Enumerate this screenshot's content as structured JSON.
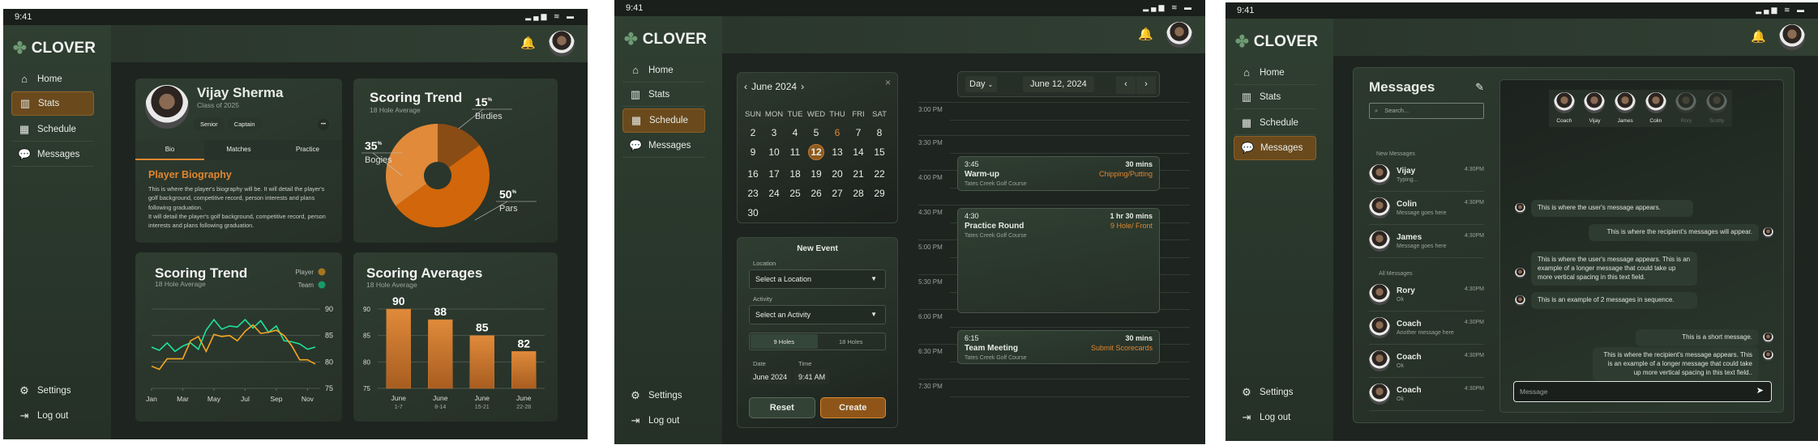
{
  "app": {
    "name": "CLOVER",
    "status_time": "9:41",
    "nav": [
      "Home",
      "Stats",
      "Schedule",
      "Messages"
    ],
    "nav_icons": [
      "home-icon",
      "stats-icon",
      "calendar-icon",
      "chat-icon"
    ],
    "settings": "Settings",
    "logout": "Log out",
    "colors": {
      "accent": "#e0862f",
      "active_nav": "#6a4a1d",
      "sidebar": "#2f3f31",
      "background": "#1e2420",
      "player": "#f5a623",
      "team": "#1fe39a"
    }
  },
  "stats": {
    "profile": {
      "name": "Vijay Sherma",
      "class": "Class of 2025",
      "tags": [
        "Senior",
        "Captain"
      ],
      "more": "•••",
      "tabs": [
        "Bio",
        "Matches",
        "Practice"
      ],
      "active_tab": "Bio",
      "bio_title": "Player Biography",
      "bio_text": "This is where the player's biography will be. It will detail the player's golf background, competitive record, person interests and plans following graduation.",
      "bio_text2": "It will detail the player's golf background, competitive record, person interests and plans following graduation."
    },
    "pie_card": {
      "title": "Scoring Trend",
      "subtitle": "18 Hole Average"
    },
    "line_card": {
      "title": "Scoring Trend",
      "subtitle": "18 Hole Average"
    },
    "bar_card": {
      "title": "Scoring Averages",
      "subtitle": "18 Hole Average"
    }
  },
  "chart_data": [
    {
      "type": "pie",
      "donut": true,
      "slices": [
        {
          "label": "Birdies",
          "value": 15,
          "color": "#8a4c15"
        },
        {
          "label": "Pars",
          "value": 50,
          "color": "#d2660a"
        },
        {
          "label": "Bogies",
          "value": 35,
          "color": "#e08a3a"
        }
      ],
      "value_suffix": "%"
    },
    {
      "type": "line",
      "xticks": [
        "Jan",
        "Mar",
        "May",
        "Jul",
        "Sep",
        "Nov"
      ],
      "xtick_values": [
        1,
        3,
        5,
        7,
        9,
        11
      ],
      "xlim": [
        1,
        11.5
      ],
      "ylim": [
        75,
        90
      ],
      "yticks": [
        75,
        80,
        85,
        90
      ],
      "y_axis_side": "right",
      "grid": true,
      "legend": "top-right",
      "x": [
        1,
        1.5,
        2,
        2.5,
        3,
        3.5,
        4,
        4.5,
        5,
        5.5,
        6,
        6.5,
        7,
        7.5,
        8,
        8.5,
        9,
        9.5,
        10,
        10.5,
        11,
        11.5
      ],
      "series": [
        {
          "name": "Player",
          "color": "#f5a623",
          "values": [
            79.2,
            78.6,
            80.6,
            80.6,
            80.6,
            84.0,
            84.8,
            82.0,
            85.2,
            84.8,
            85.0,
            84.0,
            85.8,
            87.0,
            85.4,
            85.6,
            86.0,
            85.0,
            83.0,
            80.4,
            80.4,
            79.6
          ]
        },
        {
          "name": "Team",
          "color": "#1fe39a",
          "values": [
            82.8,
            82.2,
            83.6,
            82.0,
            83.0,
            83.6,
            82.4,
            86.0,
            88.0,
            86.2,
            86.8,
            86.6,
            88.0,
            86.4,
            87.8,
            85.6,
            86.8,
            84.0,
            83.8,
            83.4,
            82.4,
            82.8
          ]
        }
      ]
    },
    {
      "type": "bar",
      "categories": [
        "June 1-7",
        "June 8-14",
        "June 15-21",
        "June 22-28"
      ],
      "category_lines": [
        [
          "June",
          "1-7"
        ],
        [
          "June",
          "8-14"
        ],
        [
          "June",
          "15-21"
        ],
        [
          "June",
          "22-28"
        ]
      ],
      "values": [
        90,
        88,
        85,
        82
      ],
      "ylim": [
        75,
        90
      ],
      "yticks": [
        75,
        80,
        85,
        90
      ],
      "grid": true,
      "color": "#d9802f"
    }
  ],
  "schedule": {
    "calendar": {
      "month": "June 2024",
      "close": "×",
      "weekdays": [
        "SUN",
        "MON",
        "TUE",
        "WED",
        "THU",
        "FRI",
        "SAT"
      ],
      "days": [
        2,
        3,
        4,
        5,
        6,
        7,
        8,
        9,
        10,
        11,
        12,
        13,
        14,
        15,
        16,
        17,
        18,
        19,
        20,
        21,
        22,
        23,
        24,
        25,
        26,
        27,
        28,
        29,
        30
      ],
      "highlight_day": 6,
      "selected_day": 12
    },
    "new_event": {
      "title": "New Event",
      "location_label": "Location",
      "location_placeholder": "Select a Location",
      "activity_label": "Activity",
      "activity_placeholder": "Select an Activity",
      "holes": [
        "9 Holes",
        "18 Holes"
      ],
      "holes_selected": "9 Holes",
      "date_label": "Date",
      "date_value": "June 2024",
      "time_label": "Time",
      "time_value": "9:41 AM",
      "reset": "Reset",
      "create": "Create"
    },
    "toolbar": {
      "view": "Day",
      "date": "June 12, 2024"
    },
    "times": [
      "3:00 PM",
      "3:30 PM",
      "4:00 PM",
      "4:30 PM",
      "5:00 PM",
      "5:30 PM",
      "6:00 PM",
      "6:30 PM",
      "7:30 PM"
    ],
    "events": [
      {
        "start": "3:45",
        "duration": "30 mins",
        "title": "Warm-up",
        "type": "Chipping/Putting",
        "location": "Tates Creek Golf Course"
      },
      {
        "start": "4:30",
        "duration": "1 hr 30 mins",
        "title": "Practice Round",
        "type": "9 Hole/ Front",
        "location": "Tates Creek Golf Course"
      },
      {
        "start": "6:15",
        "duration": "30 mins",
        "title": "Team Meeting",
        "type": "Submit Scorecards",
        "location": "Tates Creek Golf Course"
      }
    ]
  },
  "messages": {
    "title": "Messages",
    "search_placeholder": "Search...",
    "new_label": "New Messages",
    "all_label": "All Messages",
    "new": [
      {
        "name": "Vijay",
        "preview": "Typing...",
        "time": "4:30PM"
      },
      {
        "name": "Colin",
        "preview": "Message goes here",
        "time": "4:30PM"
      },
      {
        "name": "James",
        "preview": "Message goes here",
        "time": "4:30PM"
      }
    ],
    "all": [
      {
        "name": "Rory",
        "preview": "Ok",
        "time": "4:30PM"
      },
      {
        "name": "Coach",
        "preview": "Another message here",
        "time": "4:30PM"
      },
      {
        "name": "Coach",
        "preview": "Ok",
        "time": "4:30PM"
      },
      {
        "name": "Coach",
        "preview": "Ok",
        "time": "4:30PM"
      }
    ],
    "participants": [
      {
        "name": "Coach",
        "active": true
      },
      {
        "name": "Vijay",
        "active": true
      },
      {
        "name": "James",
        "active": true
      },
      {
        "name": "Colin",
        "active": true
      },
      {
        "name": "Rory",
        "active": false
      },
      {
        "name": "Scotty",
        "active": false
      }
    ],
    "bubbles": [
      {
        "side": "left",
        "text": "This is where the user's message appears."
      },
      {
        "side": "right",
        "text": "This is where the recipient's messages will appear."
      },
      {
        "side": "left",
        "text": "This is where the user's message appears. This is an example of a longer message that could take up more vertical spacing in this text field."
      },
      {
        "side": "left",
        "text": "This is an example of 2 messages in sequence."
      },
      {
        "side": "right",
        "text": "This is a short message."
      },
      {
        "side": "right",
        "text": "This is where the recipient's  message appears. This is an example of a longer message that could take up more vertical spacing in this text field.."
      }
    ],
    "input_placeholder": "Message"
  }
}
